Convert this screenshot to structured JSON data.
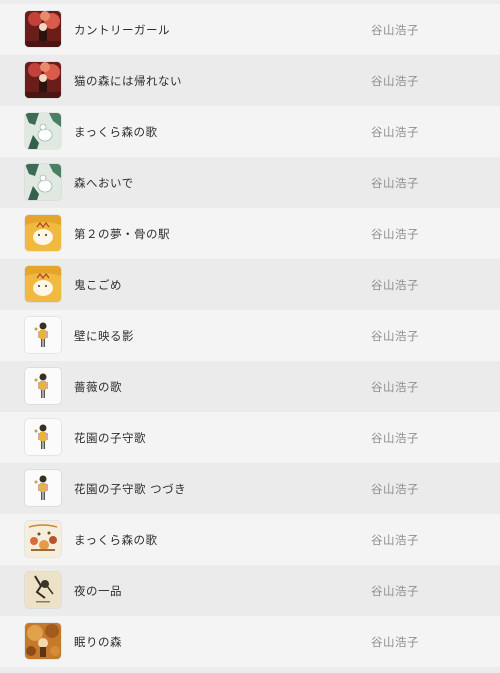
{
  "tracks": [
    {
      "title": "カントリーガール",
      "artist": "谷山浩子",
      "art": "album-art-red"
    },
    {
      "title": "猫の森には帰れない",
      "artist": "谷山浩子",
      "art": "album-art-red"
    },
    {
      "title": "まっくら森の歌",
      "artist": "谷山浩子",
      "art": "album-art-green"
    },
    {
      "title": "森へおいで",
      "artist": "谷山浩子",
      "art": "album-art-green"
    },
    {
      "title": "第２の夢・骨の駅",
      "artist": "谷山浩子",
      "art": "album-art-yellow"
    },
    {
      "title": "鬼こごめ",
      "artist": "谷山浩子",
      "art": "album-art-yellow"
    },
    {
      "title": "壁に映る影",
      "artist": "谷山浩子",
      "art": "album-art-white"
    },
    {
      "title": "薔薇の歌",
      "artist": "谷山浩子",
      "art": "album-art-white"
    },
    {
      "title": "花園の子守歌",
      "artist": "谷山浩子",
      "art": "album-art-white"
    },
    {
      "title": "花園の子守歌 つづき",
      "artist": "谷山浩子",
      "art": "album-art-white"
    },
    {
      "title": "まっくら森の歌",
      "artist": "谷山浩子",
      "art": "album-art-cream"
    },
    {
      "title": "夜の一品",
      "artist": "谷山浩子",
      "art": "album-art-beige"
    },
    {
      "title": "眠りの森",
      "artist": "谷山浩子",
      "art": "album-art-orange"
    }
  ]
}
